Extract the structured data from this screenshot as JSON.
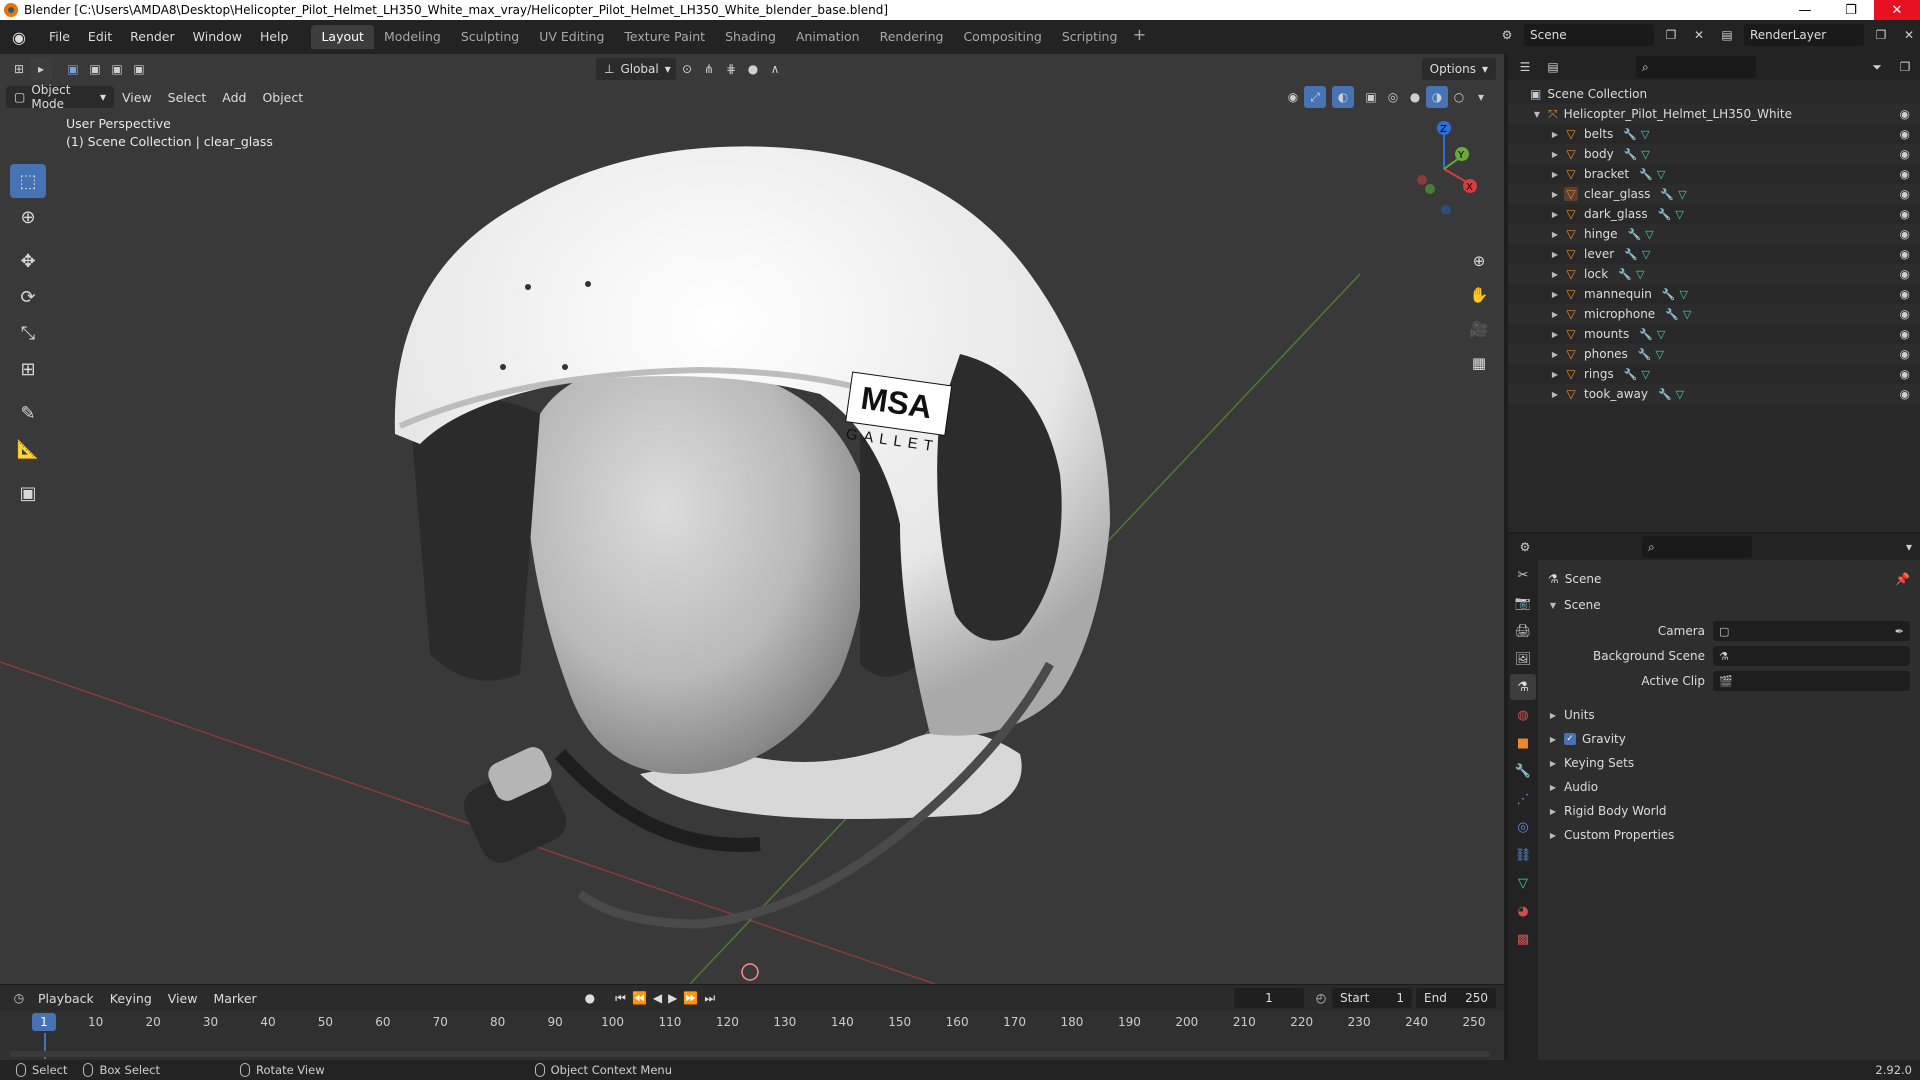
{
  "window": {
    "title": "Blender [C:\\Users\\AMDA8\\Desktop\\Helicopter_Pilot_Helmet_LH350_White_max_vray/Helicopter_Pilot_Helmet_LH350_White_blender_base.blend]",
    "minimize": "—",
    "maximize": "❐",
    "close": "✕"
  },
  "menu": [
    "File",
    "Edit",
    "Render",
    "Window",
    "Help"
  ],
  "workspaces": [
    "Layout",
    "Modeling",
    "Sculpting",
    "UV Editing",
    "Texture Paint",
    "Shading",
    "Animation",
    "Rendering",
    "Compositing",
    "Scripting"
  ],
  "active_workspace": "Layout",
  "scene_selector": {
    "scene": "Scene",
    "view_layer": "RenderLayer"
  },
  "viewport": {
    "mode": "Object Mode",
    "menus": [
      "View",
      "Select",
      "Add",
      "Object"
    ],
    "transform_orientation": "Global",
    "options_label": "Options",
    "overlay_line1": "User Perspective",
    "overlay_line2": "(1) Scene Collection | clear_glass",
    "helmet_logo_line1": "MSA",
    "helmet_logo_line2": "GALLET",
    "gizmo_axes": {
      "x": "X",
      "y": "Y",
      "z": "Z"
    }
  },
  "timeline": {
    "menus": [
      "Playback",
      "Keying",
      "View",
      "Marker"
    ],
    "current_frame": "1",
    "start_label": "Start",
    "start": "1",
    "end_label": "End",
    "end": "250",
    "ticks": [
      "10",
      "20",
      "30",
      "40",
      "50",
      "60",
      "70",
      "80",
      "90",
      "100",
      "110",
      "120",
      "130",
      "140",
      "150",
      "160",
      "170",
      "180",
      "190",
      "200",
      "210",
      "220",
      "230",
      "240",
      "250"
    ],
    "cursor_label": "1"
  },
  "statusbar": {
    "select": "Select",
    "box_select": "Box Select",
    "rotate_view": "Rotate View",
    "context_menu": "Object Context Menu",
    "version": "2.92.0"
  },
  "outliner": {
    "root": "Scene Collection",
    "collection": "Helicopter_Pilot_Helmet_LH350_White",
    "objects": [
      "belts",
      "body",
      "bracket",
      "clear_glass",
      "dark_glass",
      "hinge",
      "lever",
      "lock",
      "mannequin",
      "microphone",
      "mounts",
      "phones",
      "rings",
      "took_away"
    ],
    "selected": "clear_glass"
  },
  "properties": {
    "context": "Scene",
    "panel_title": "Scene",
    "camera_label": "Camera",
    "background_scene_label": "Background Scene",
    "active_clip_label": "Active Clip",
    "subpanels": [
      "Units",
      "Gravity",
      "Keying Sets",
      "Audio",
      "Rigid Body World",
      "Custom Properties"
    ],
    "gravity_checked": true
  },
  "colors": {
    "accent": "#4772b3",
    "mesh_orange": "#ea8a2c",
    "viewport_bg": "#393939"
  }
}
